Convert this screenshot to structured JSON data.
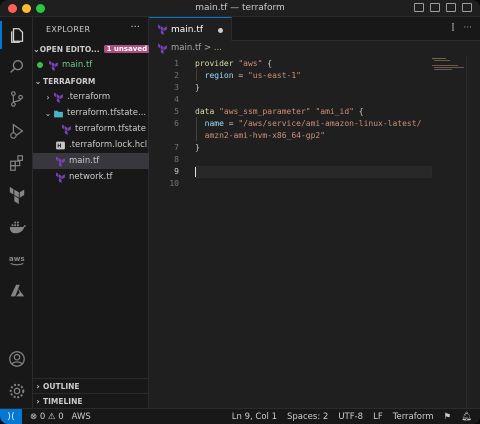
{
  "window": {
    "title": "main.tf — terraform"
  },
  "colors": {
    "accent": "#0078d4",
    "badge": "#ab4f7d",
    "terraform": "#7b42bc"
  },
  "activity_bar": {
    "top_icons": [
      "files-icon",
      "search-icon",
      "source-control-icon",
      "run-debug-icon",
      "extensions-icon",
      "terraform-icon",
      "docker-icon",
      "aws-icon",
      "azure-icon"
    ],
    "bottom_icons": [
      "account-icon",
      "settings-gear-icon"
    ]
  },
  "sidebar": {
    "header": "EXPLORER",
    "more": "···",
    "open_editors": {
      "label": "OPEN EDITO...",
      "badge": "1 unsaved",
      "files": [
        "main.tf"
      ]
    },
    "workspace": {
      "label": "TERRAFORM",
      "items": [
        {
          "label": ".terraform",
          "kind": "folder",
          "expanded": false
        },
        {
          "label": "terraform.tfstate...",
          "kind": "folder",
          "expanded": true
        },
        {
          "label": "terraform.tfstate",
          "kind": "file"
        },
        {
          "label": ".terraform.lock.hcl",
          "kind": "file"
        },
        {
          "label": "main.tf",
          "kind": "file"
        },
        {
          "label": "network.tf",
          "kind": "file"
        }
      ]
    },
    "outline": "OUTLINE",
    "timeline": "TIMELINE"
  },
  "tabs": [
    {
      "label": "main.tf",
      "unsaved": true
    }
  ],
  "breadcrumb": "main.tf > ...",
  "editor": {
    "cursor_line": 9,
    "lines": [
      {
        "n": "1",
        "tokens": [
          {
            "t": "provider ",
            "c": "kw"
          },
          {
            "t": "\"aws\"",
            "c": "str"
          },
          {
            "t": " {",
            "c": "pun"
          }
        ]
      },
      {
        "n": "2",
        "tokens": [
          {
            "t": "  region",
            "c": "prop"
          },
          {
            "t": " = ",
            "c": "pun"
          },
          {
            "t": "\"us-east-1\"",
            "c": "str"
          }
        ]
      },
      {
        "n": "3",
        "tokens": [
          {
            "t": "}",
            "c": "pun"
          }
        ]
      },
      {
        "n": "4",
        "tokens": []
      },
      {
        "n": "5",
        "tokens": [
          {
            "t": "data ",
            "c": "kw"
          },
          {
            "t": "\"aws_ssm_parameter\"",
            "c": "str"
          },
          {
            "t": " ",
            "c": "pun"
          },
          {
            "t": "\"ami_id\"",
            "c": "str"
          },
          {
            "t": " {",
            "c": "pun"
          }
        ]
      },
      {
        "n": "6",
        "tokens": [
          {
            "t": "  name",
            "c": "prop"
          },
          {
            "t": " = ",
            "c": "pun"
          },
          {
            "t": "\"/aws/service/ami-amazon-linux-latest/",
            "c": "str"
          }
        ]
      },
      {
        "n": "",
        "tokens": [
          {
            "t": "  amzn2-ami-hvm-x86_64-gp2\"",
            "c": "str"
          }
        ]
      },
      {
        "n": "7",
        "tokens": [
          {
            "t": "}",
            "c": "pun"
          }
        ]
      },
      {
        "n": "8",
        "tokens": []
      },
      {
        "n": "9",
        "tokens": []
      },
      {
        "n": "10",
        "tokens": []
      }
    ]
  },
  "status_bar": {
    "remote": "⟩⟨",
    "problems": "⊗ 0  ⚠ 0",
    "aws": "AWS",
    "position": "Ln 9, Col 1",
    "spaces": "Spaces: 2",
    "encoding": "UTF-8",
    "eol": "LF",
    "language": "Terraform"
  }
}
